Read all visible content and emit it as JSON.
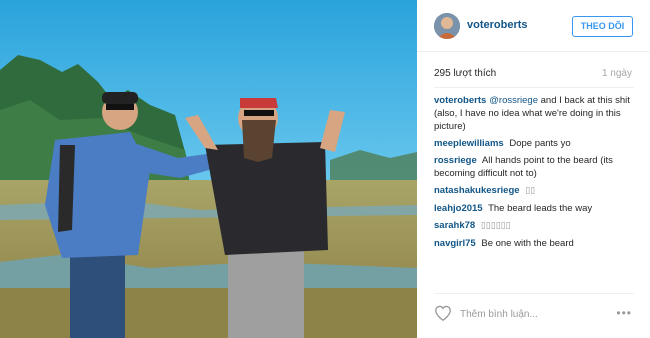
{
  "post": {
    "author": "voteroberts",
    "follow_label": "THEO DÕI",
    "likes": "295 lượt thích",
    "time_ago": "1 ngày"
  },
  "comments": [
    {
      "user": "voteroberts",
      "mention": "@rossriege",
      "text": " and I back at this shit (also, I have no idea what we're doing in this picture)"
    },
    {
      "user": "meeplewilliams",
      "text": "Dope pants yo"
    },
    {
      "user": "rossriege",
      "text": "All hands point to the beard (its becoming difficult not to)"
    },
    {
      "user": "natashakukesriege",
      "text": "▯▯"
    },
    {
      "user": "leahjo2015",
      "text": "The beard leads the way"
    },
    {
      "user": "sarahk78",
      "text": "▯▯▯▯▯▯"
    },
    {
      "user": "navgirl75",
      "text": "Be one with the beard"
    }
  ],
  "footer": {
    "comment_placeholder": "Thêm bình luận...",
    "more_label": "•••"
  },
  "icons": {
    "like": "heart-icon",
    "more": "more-options-icon",
    "avatar": "profile-avatar"
  }
}
